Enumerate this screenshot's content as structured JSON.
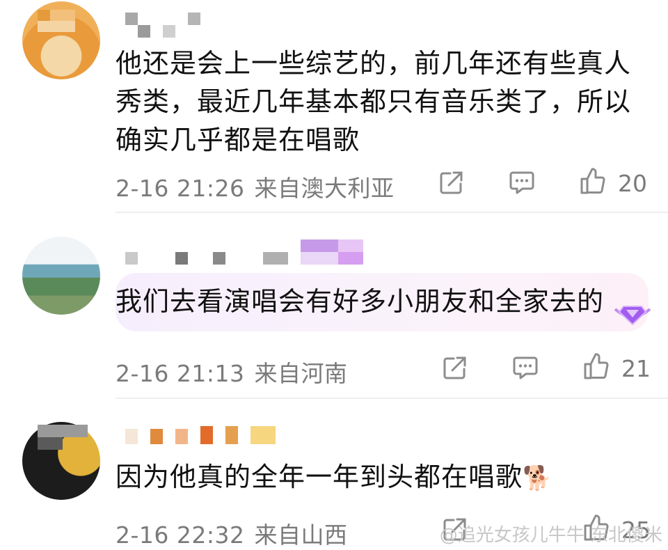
{
  "comments": [
    {
      "text_lines": [
        "他还是会上一些综艺的，前几年还有些真人",
        "秀类，最近几年基本都只有音乐类了，所以",
        "确实几乎都是在唱歌"
      ],
      "time": "2-16 21:26",
      "region": "来自澳大利亚",
      "likes": "20",
      "avatar": "dog-photo"
    },
    {
      "text_lines": [
        "我们去看演唱会有好多小朋友和全家去的"
      ],
      "time": "2-16 21:13",
      "region": "来自河南",
      "likes": "21",
      "avatar": "landscape-photo",
      "highlighted": true
    },
    {
      "text_lines": [
        "因为他真的全年一年到头都在唱歌"
      ],
      "emoji": "🐕",
      "time": "2-16 22:32",
      "region": "来自山西",
      "likes": "25",
      "avatar": "black-cat-photo"
    }
  ],
  "icons": {
    "share": "share-icon",
    "reply": "comment-icon",
    "like": "thumbs-up-icon"
  },
  "watermark": "@追光女孩儿牛牛 东北傻米",
  "colors": {
    "text": "#111111",
    "meta": "#7a7a7a",
    "divider": "#eeeeee",
    "highlight": "#f6eefc"
  }
}
